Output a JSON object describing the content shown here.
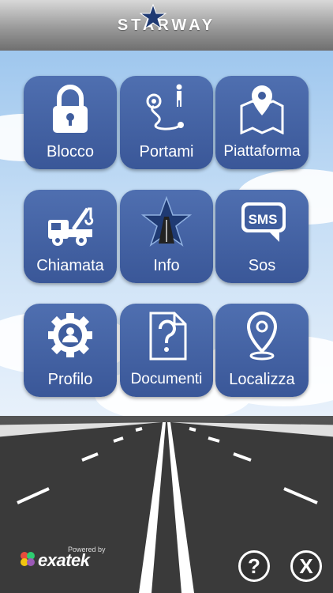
{
  "header": {
    "brand": "STARWAY"
  },
  "tiles": [
    {
      "label": "Blocco",
      "icon": "lock-icon"
    },
    {
      "label": "Portami",
      "icon": "route-icon"
    },
    {
      "label": "Piattaforma",
      "icon": "map-pin-icon"
    },
    {
      "label": "Chiamata",
      "icon": "tow-truck-icon"
    },
    {
      "label": "Info",
      "icon": "star-road-icon"
    },
    {
      "label": "Sos",
      "icon": "sms-icon"
    },
    {
      "label": "Profilo",
      "icon": "gear-user-icon"
    },
    {
      "label": "Documenti",
      "icon": "document-question-icon"
    },
    {
      "label": "Localizza",
      "icon": "location-icon"
    }
  ],
  "sms_text": "SMS",
  "footer": {
    "powered_by": "Powered by",
    "company": "exatek",
    "help_glyph": "?",
    "close_glyph": "X"
  },
  "colors": {
    "tile": "#3f5d9e",
    "sky": "#b7d4f2",
    "header": "#9a9a9a"
  }
}
